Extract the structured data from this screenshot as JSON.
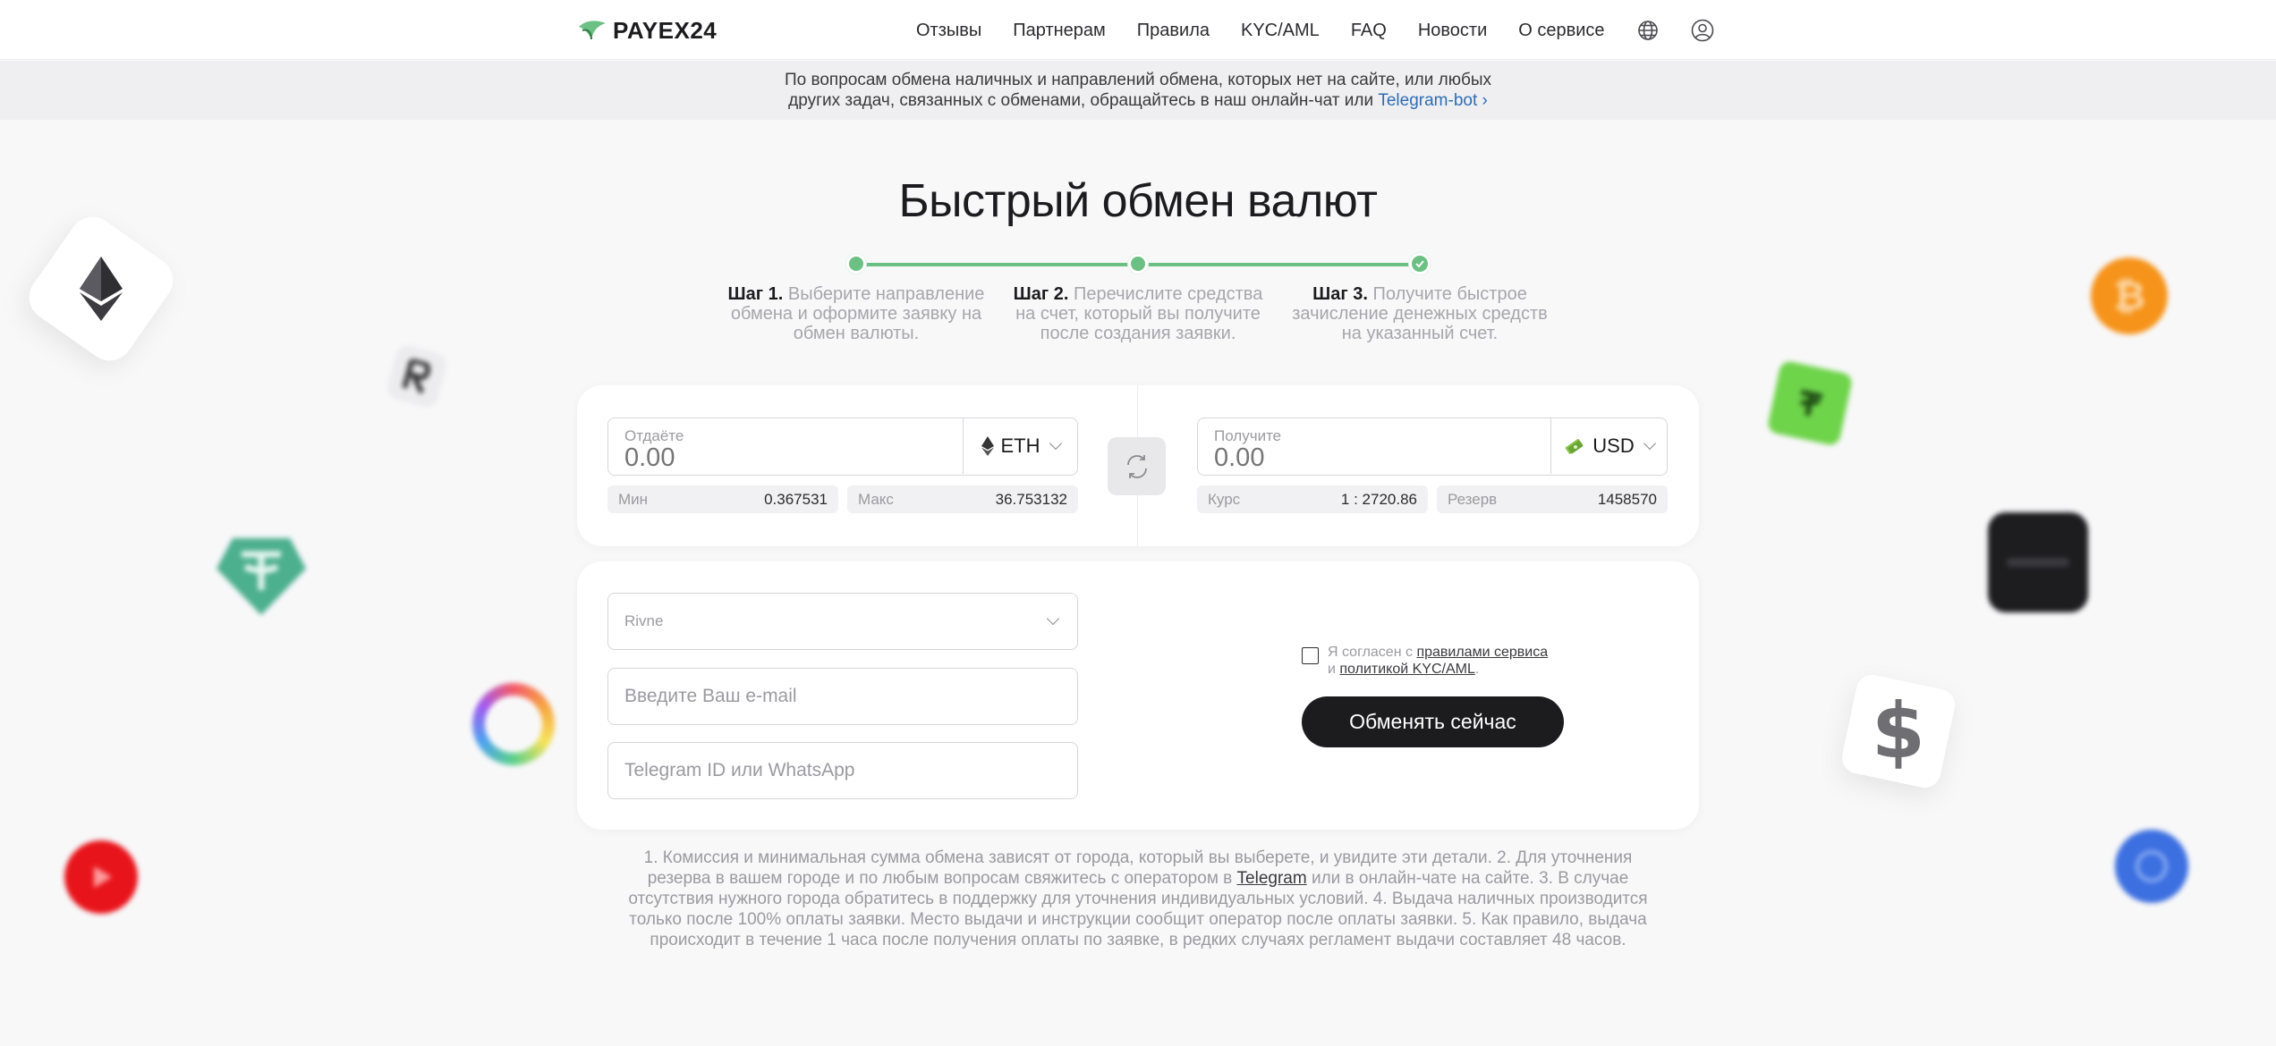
{
  "header": {
    "logo": "PAYEX24",
    "nav": [
      "Отзывы",
      "Партнерам",
      "Правила",
      "KYC/AML",
      "FAQ",
      "Новости",
      "О сервисе"
    ],
    "icons": [
      "globe-icon",
      "user-icon"
    ]
  },
  "notice": {
    "line1": "По вопросам обмена наличных и направлений обмена, которых нет на сайте, или любых",
    "line2": "других задач, связанных с обменами, обращайтесь в наш онлайн-чат или",
    "link": "Telegram-bot ›"
  },
  "title": "Быстрый обмен валют",
  "steps": [
    {
      "label": "Шаг 1.",
      "text": "Выберите направление обмена и оформите заявку на обмен валюты."
    },
    {
      "label": "Шаг 2.",
      "text": "Перечислите средства на счет, который вы получите после создания заявки."
    },
    {
      "label": "Шаг 3.",
      "text": "Получите быстрое зачисление денежных средств на указанный счет."
    }
  ],
  "give": {
    "label": "Отдаёте",
    "placeholder": "0.00",
    "currency": "ETH",
    "min_label": "Мин",
    "min_value": "0.367531",
    "max_label": "Макс",
    "max_value": "36.753132"
  },
  "get": {
    "label": "Получите",
    "placeholder": "0.00",
    "currency": "USD",
    "rate_label": "Курс",
    "rate_value": "1 : 2720.86",
    "reserve_label": "Резерв",
    "reserve_value": "1458570"
  },
  "form": {
    "city": "Rivne",
    "email_placeholder": "Введите Ваш e-mail",
    "contact_placeholder": "Telegram ID или WhatsApp",
    "agree_prefix": "Я согласен с",
    "agree_rules": "правилами сервиса",
    "agree_and": "и",
    "agree_kyc": "политикой KYC/AML",
    "agree_end": ".",
    "submit": "Обменять сейчас"
  },
  "notes": {
    "part1": "1. Комиссия и минимальная сумма обмена зависят от города, который вы выберете, и увидите эти детали.   2. Для уточнения резерва в вашем городе и по любым вопросам свяжитесь с оператором в",
    "link": "Telegram",
    "part2": "или в онлайн-чате на сайте.   3. В случае отсутствия нужного города обратитесь в поддержку для уточнения индивидуальных условий.   4. Выдача наличных производится только после 100% оплаты заявки. Место выдачи и инструкции сообщит оператор после оплаты заявки.   5. Как правило, выдача происходит в течение 1 часа после получения оплаты по заявке, в редких случаях регламент выдачи составляет 48 часов."
  },
  "colors": {
    "accent_green": "#6cc083",
    "link_blue": "#2d6db5",
    "button_dark": "#1c1c1e"
  }
}
